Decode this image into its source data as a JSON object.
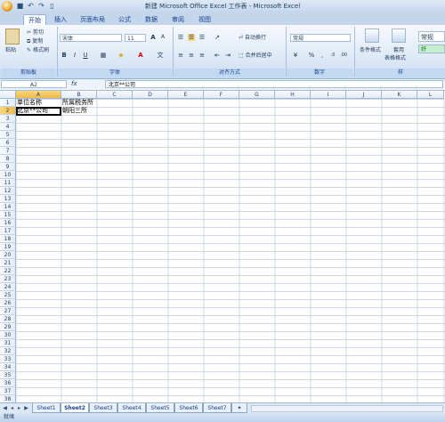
{
  "window": {
    "title": "新建 Microsoft Office Excel 工作表 - Microsoft Excel"
  },
  "ribbon_tabs": [
    "开始",
    "插入",
    "页面布局",
    "公式",
    "数据",
    "审阅",
    "视图"
  ],
  "clipboard": {
    "paste": "粘贴",
    "cut": "剪切",
    "copy": "复制",
    "format_painter": "格式刷",
    "group": "剪贴板"
  },
  "font": {
    "name": "宋体",
    "size": "11",
    "group": "字体",
    "bold": "B",
    "italic": "I",
    "underline": "U",
    "wen": "文"
  },
  "alignment": {
    "wrap": "自动换行",
    "merge": "合并后居中",
    "group": "对齐方式"
  },
  "number": {
    "format": "常规",
    "percent": "%",
    "comma": ",",
    "group": "数字"
  },
  "styles": {
    "conditional": "条件格式",
    "apply": "套用",
    "table_format": "表格格式",
    "normal": "常规",
    "good": "好",
    "group": "样"
  },
  "formula_bar": {
    "name_box": "A2",
    "fx": "fx",
    "value": "北京**公司"
  },
  "columns": [
    "A",
    "B",
    "C",
    "D",
    "E",
    "F",
    "G",
    "H",
    "I",
    "J",
    "K",
    "L"
  ],
  "rows": [
    "1",
    "2",
    "3",
    "4",
    "5",
    "6",
    "7",
    "8",
    "9",
    "10",
    "11",
    "12",
    "13",
    "14",
    "15",
    "16",
    "17",
    "18",
    "19",
    "20",
    "21",
    "22",
    "23",
    "24",
    "25",
    "26",
    "27",
    "28",
    "29",
    "30",
    "31",
    "32",
    "33",
    "34",
    "35",
    "36",
    "37",
    "38"
  ],
  "cells": {
    "A1": "单位名称",
    "B1": "所属税务所",
    "A2": "北京**公司",
    "B2": "朝阳三所"
  },
  "sheets": [
    "Sheet1",
    "Sheet2",
    "Sheet3",
    "Sheet4",
    "Sheet5",
    "Sheet6",
    "Sheet7"
  ],
  "active_sheet": "Sheet2",
  "status": "就绪"
}
